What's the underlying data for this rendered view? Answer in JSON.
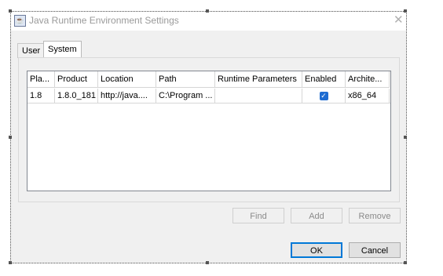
{
  "window": {
    "title": "Java Runtime Environment Settings"
  },
  "tabs": [
    {
      "label": "User",
      "active": false
    },
    {
      "label": "System",
      "active": true
    }
  ],
  "table": {
    "columns": [
      "Pla...",
      "Product",
      "Location",
      "Path",
      "Runtime Parameters",
      "Enabled",
      "Archite..."
    ],
    "rows": [
      {
        "platform": "1.8",
        "product": "1.8.0_181",
        "location": "http://java....",
        "path": "C:\\Program ...",
        "runtime_parameters": "",
        "enabled": true,
        "architecture": "x86_64"
      }
    ]
  },
  "buttons": {
    "find": "Find",
    "add": "Add",
    "remove": "Remove",
    "ok": "OK",
    "cancel": "Cancel"
  },
  "icons": {
    "app": "java-icon",
    "close": "close-icon",
    "check": "checkmark-icon"
  }
}
